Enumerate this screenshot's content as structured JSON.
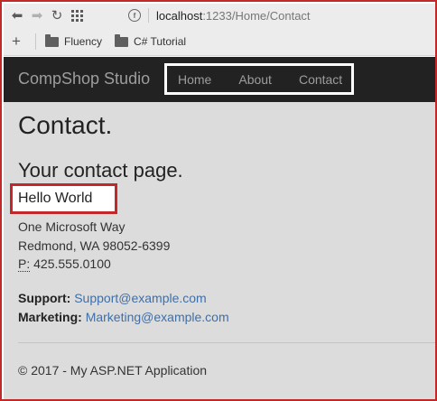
{
  "browser": {
    "icons": [
      "back-arrow-icon",
      "forward-arrow-icon",
      "reload-icon",
      "apps-grid-icon",
      "site-info-icon"
    ],
    "url_host": "localhost",
    "url_path": ":1233/Home/Contact",
    "bookmarks": [
      {
        "label": "Fluency",
        "icon": "folder-icon"
      },
      {
        "label": "C# Tutorial",
        "icon": "folder-icon"
      }
    ]
  },
  "navbar": {
    "brand": "CompShop Studio",
    "links": [
      "Home",
      "About",
      "Contact"
    ]
  },
  "page": {
    "title": "Contact.",
    "subtitle": "Your contact page.",
    "hello": "Hello World",
    "address": {
      "line1": "One Microsoft Way",
      "line2": "Redmond, WA 98052-6399",
      "phone_abbr": "P:",
      "phone": "425.555.0100"
    },
    "support_label": "Support:",
    "support_email": "Support@example.com",
    "marketing_label": "Marketing:",
    "marketing_email": "Marketing@example.com",
    "footer": "© 2017 - My ASP.NET Application"
  },
  "colors": {
    "highlight_border": "#c0282a",
    "navbar_bg": "#222222",
    "content_bg": "#dcdcdc",
    "link": "#3f6fa8"
  }
}
